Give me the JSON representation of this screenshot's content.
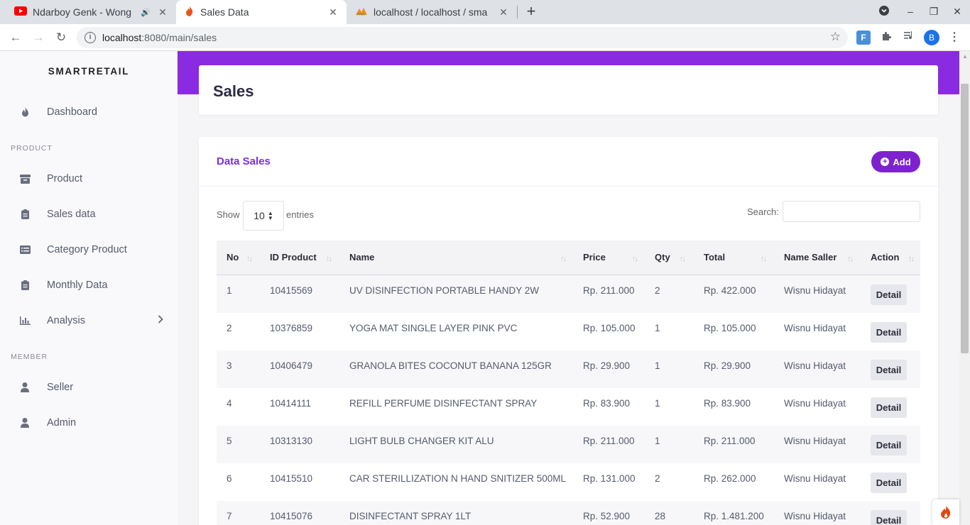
{
  "browser": {
    "tabs": [
      {
        "title": "Ndarboy Genk - Wong",
        "icon": "youtube-icon",
        "audio": true
      },
      {
        "title": "Sales Data",
        "icon": "codeigniter-icon",
        "active": true
      },
      {
        "title": "localhost / localhost / sma",
        "icon": "phpmyadmin-icon"
      }
    ],
    "url_host": "localhost",
    "url_path": ":8080/main/sales",
    "profile_initial": "B"
  },
  "sidebar": {
    "brand": "SMARTRETAIL",
    "dashboard": {
      "label": "Dashboard",
      "icon": "fire-icon"
    },
    "section_product": "PRODUCT",
    "items_product": [
      {
        "label": "Product",
        "icon": "box-icon"
      },
      {
        "label": "Sales data",
        "icon": "clipboard-icon"
      },
      {
        "label": "Category Product",
        "icon": "list-icon"
      },
      {
        "label": "Monthly Data",
        "icon": "clipboard-icon"
      },
      {
        "label": "Analysis",
        "icon": "chart-icon",
        "has_submenu": true
      }
    ],
    "section_member": "MEMBER",
    "items_member": [
      {
        "label": "Seller",
        "icon": "user-icon"
      },
      {
        "label": "Admin",
        "icon": "user-icon"
      }
    ]
  },
  "page": {
    "title": "Sales"
  },
  "card": {
    "title": "Data Sales",
    "add_label": "Add",
    "show_label": "Show",
    "entries_value": "10",
    "entries_label": "entries",
    "search_label": "Search:",
    "search_value": ""
  },
  "table": {
    "columns": [
      "No",
      "ID Product",
      "Name",
      "Price",
      "Qty",
      "Total",
      "Name Saller",
      "Action"
    ],
    "detail_label": "Detail",
    "rows": [
      {
        "no": "1",
        "id": "10415569",
        "name": "UV DISINFECTION PORTABLE HANDY 2W",
        "price": "Rp. 211.000",
        "qty": "2",
        "total": "Rp. 422.000",
        "seller": "Wisnu Hidayat"
      },
      {
        "no": "2",
        "id": "10376859",
        "name": "YOGA MAT SINGLE LAYER PINK PVC",
        "price": "Rp. 105.000",
        "qty": "1",
        "total": "Rp. 105.000",
        "seller": "Wisnu Hidayat"
      },
      {
        "no": "3",
        "id": "10406479",
        "name": "GRANOLA BITES COCONUT BANANA 125GR",
        "price": "Rp. 29.900",
        "qty": "1",
        "total": "Rp. 29.900",
        "seller": "Wisnu Hidayat"
      },
      {
        "no": "4",
        "id": "10414111",
        "name": "REFILL PERFUME DISINFECTANT SPRAY",
        "price": "Rp. 83.900",
        "qty": "1",
        "total": "Rp. 83.900",
        "seller": "Wisnu Hidayat"
      },
      {
        "no": "5",
        "id": "10313130",
        "name": "LIGHT BULB CHANGER KIT ALU",
        "price": "Rp. 211.000",
        "qty": "1",
        "total": "Rp. 211.000",
        "seller": "Wisnu Hidayat"
      },
      {
        "no": "6",
        "id": "10415510",
        "name": "CAR STERILLIZATION N HAND SNITIZER 500ML",
        "price": "Rp. 131.000",
        "qty": "2",
        "total": "Rp. 262.000",
        "seller": "Wisnu Hidayat"
      },
      {
        "no": "7",
        "id": "10415076",
        "name": "DISINFECTANT SPRAY 1LT",
        "price": "Rp. 52.900",
        "qty": "28",
        "total": "Rp. 1.481.200",
        "seller": "Wisnu Hidayat"
      }
    ]
  },
  "colors": {
    "banner": "#8a2be2",
    "accent": "#7e22ce",
    "title_accent": "#7b2fe0"
  }
}
